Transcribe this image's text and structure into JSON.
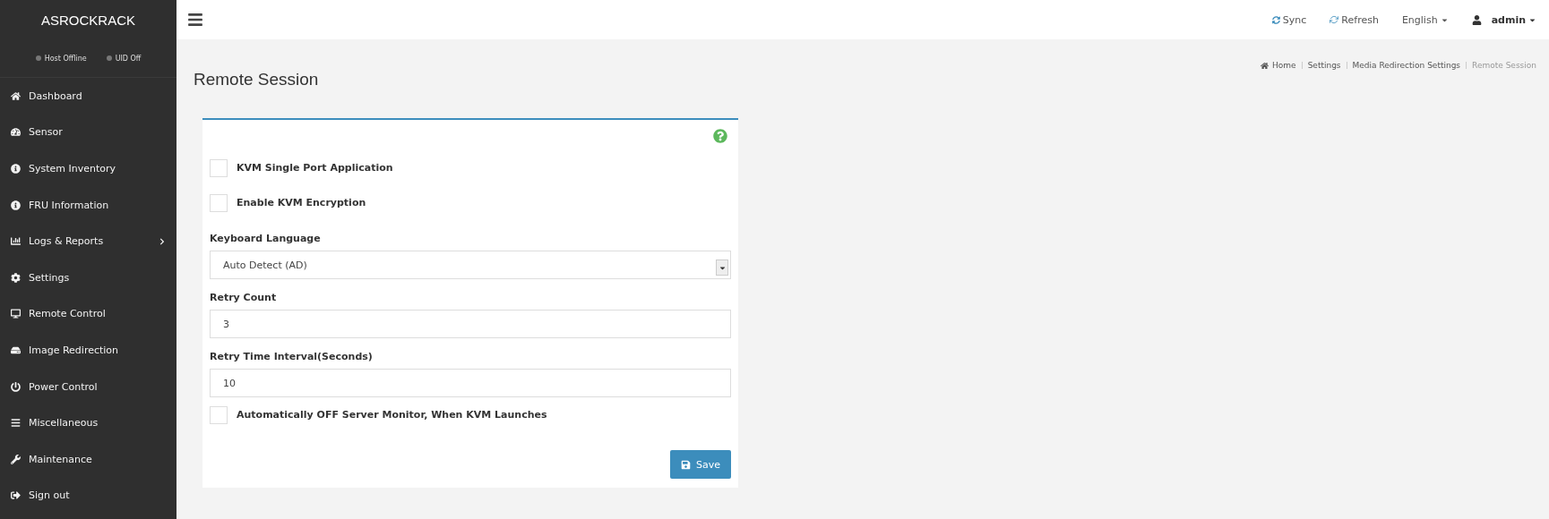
{
  "sidebar": {
    "brand": "ASROCKRACK",
    "status": [
      {
        "label": "Host Offline"
      },
      {
        "label": "UID Off"
      }
    ],
    "items": [
      {
        "label": "Dashboard",
        "has_submenu": false
      },
      {
        "label": "Sensor",
        "has_submenu": false
      },
      {
        "label": "System Inventory",
        "has_submenu": false
      },
      {
        "label": "FRU Information",
        "has_submenu": false
      },
      {
        "label": "Logs & Reports",
        "has_submenu": true
      },
      {
        "label": "Settings",
        "has_submenu": false
      },
      {
        "label": "Remote Control",
        "has_submenu": false
      },
      {
        "label": "Image Redirection",
        "has_submenu": false
      },
      {
        "label": "Power Control",
        "has_submenu": false
      },
      {
        "label": "Miscellaneous",
        "has_submenu": false
      },
      {
        "label": "Maintenance",
        "has_submenu": false
      },
      {
        "label": "Sign out",
        "has_submenu": false
      }
    ]
  },
  "topbar": {
    "sync": "Sync",
    "refresh": "Refresh",
    "language": "English",
    "user": "admin"
  },
  "page": {
    "title": "Remote Session",
    "breadcrumb": [
      "Home",
      "Settings",
      "Media Redirection Settings",
      "Remote Session"
    ]
  },
  "form": {
    "fields": [
      {
        "kind": "checkbox",
        "label": "KVM Single Port Application",
        "checked": false
      },
      {
        "kind": "checkbox",
        "label": "Enable KVM Encryption",
        "checked": false
      },
      {
        "kind": "select",
        "label": "Keyboard Language",
        "value": "Auto Detect (AD)"
      },
      {
        "kind": "input",
        "label": "Retry Count",
        "value": "3"
      },
      {
        "kind": "input",
        "label": "Retry Time Interval(Seconds)",
        "value": "10"
      },
      {
        "kind": "checkbox",
        "label": "Automatically OFF Server Monitor, When KVM Launches",
        "checked": false
      }
    ],
    "save": "Save"
  }
}
